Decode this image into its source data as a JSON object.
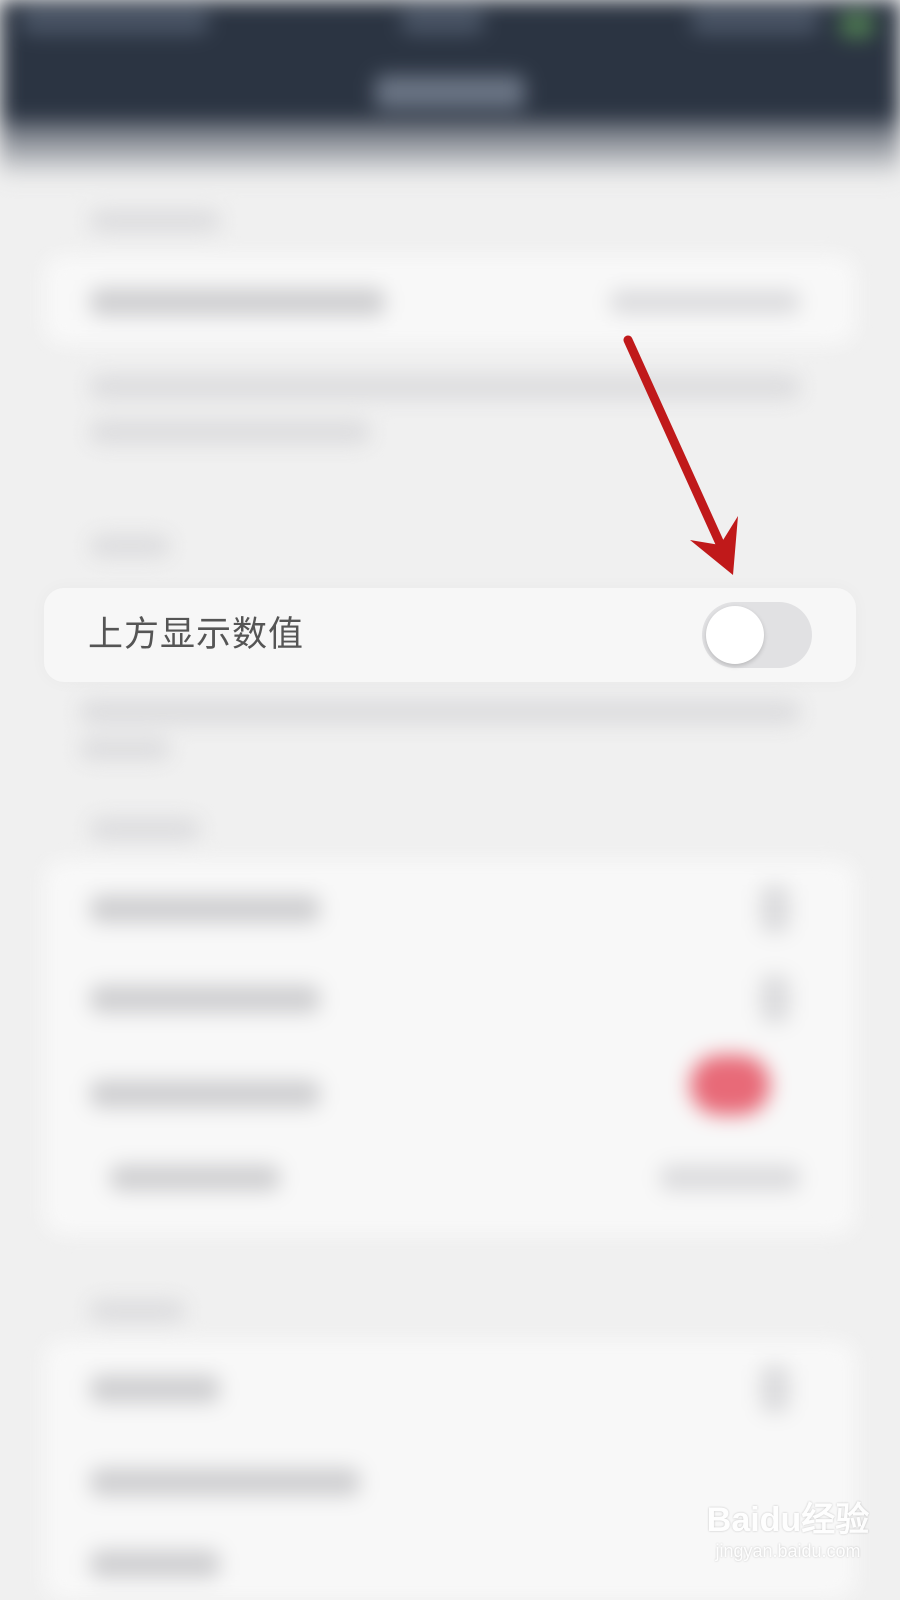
{
  "setting": {
    "label": "上方显示数值",
    "enabled": false
  },
  "colors": {
    "annotation_arrow": "#c0191a",
    "toggle_off_track": "#e1e1e3",
    "toggle_knob": "#ffffff",
    "top_bar": "#2b3442",
    "background": "#f0f0f0"
  },
  "watermark": {
    "logo": "Baidu经验",
    "url": "jingyan.baidu.com"
  }
}
